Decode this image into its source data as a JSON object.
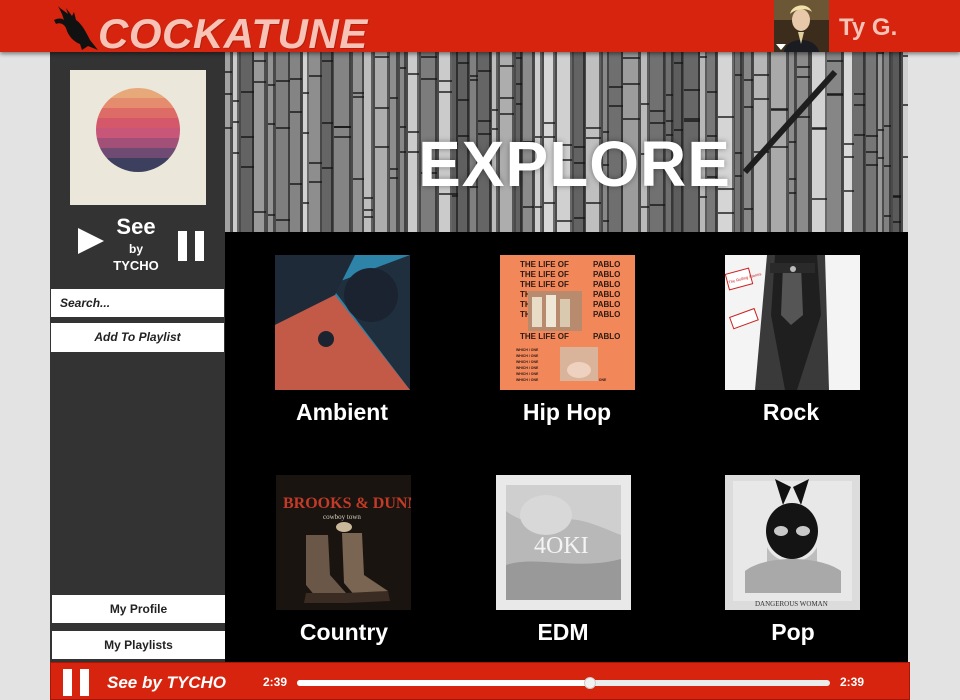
{
  "header": {
    "app_title": "COCKATUNE",
    "user_name": "Ty G."
  },
  "sidebar": {
    "now_playing": {
      "song": "See",
      "by": "by",
      "artist": "TYCHO"
    },
    "search_placeholder": "Search...",
    "add_to_playlist_label": "Add To Playlist",
    "my_profile_label": "My Profile",
    "my_playlists_label": "My Playlists"
  },
  "main": {
    "title": "EXPLORE",
    "genres": [
      {
        "label": "Ambient"
      },
      {
        "label": "Hip Hop"
      },
      {
        "label": "Rock"
      },
      {
        "label": "Country"
      },
      {
        "label": "EDM"
      },
      {
        "label": "Pop"
      }
    ],
    "covers": {
      "hiphop": {
        "line": "THE LIFE OF",
        "name": "PABLO",
        "small": "WHICH / ONE"
      },
      "rock": {
        "sticker": "The Rolling Stones"
      },
      "country": {
        "title": "BROOKS & DUNN",
        "subtitle": "cowboy town"
      },
      "edm": {
        "title": "4OKI"
      },
      "pop": {
        "caption": "DANGEROUS WOMAN"
      }
    }
  },
  "player": {
    "track": "See by TYCHO",
    "current_time": "2:39",
    "total_time": "2:39",
    "progress_fraction": 0.55
  },
  "colors": {
    "brand_red": "#d6240e",
    "logo_pink": "#f7c3b7",
    "sidebar": "#333333",
    "main_bg": "#000000"
  },
  "icons": {
    "logo": "cockatoo-icon",
    "play": "play-icon",
    "pause": "pause-icon",
    "dropdown": "caret-down-icon"
  }
}
